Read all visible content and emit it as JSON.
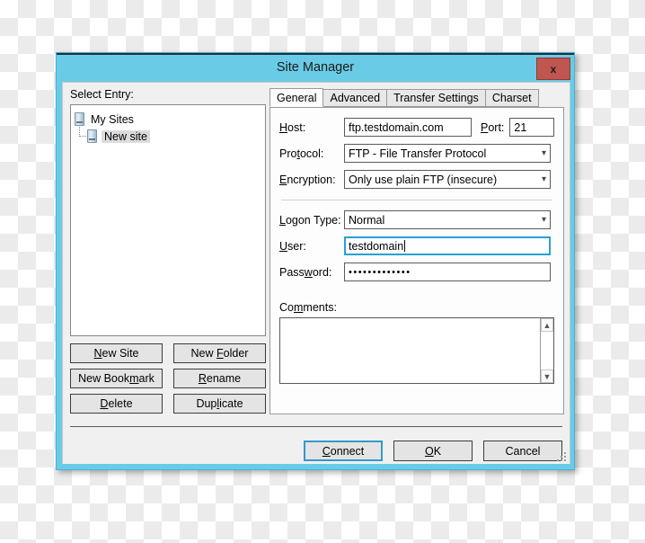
{
  "window": {
    "title": "Site Manager",
    "close_label": "x",
    "titlebar_color": "#6ACBE6",
    "close_color": "#c0564f"
  },
  "left": {
    "select_entry_label": "Select Entry:",
    "tree": [
      {
        "label": "My Sites",
        "icon": "server-icon",
        "selected": false
      },
      {
        "label": "New site",
        "icon": "server-icon",
        "selected": true
      }
    ],
    "buttons": [
      {
        "name": "new-site",
        "pre": "N",
        "acc": "",
        "label": "New Site",
        "u": "N",
        "rest": "ew Site"
      },
      {
        "name": "new-folder",
        "label": "New Folder"
      },
      {
        "name": "new-bookmark",
        "label": "New Bookmark"
      },
      {
        "name": "rename",
        "label": "Rename"
      },
      {
        "name": "delete",
        "label": "Delete"
      },
      {
        "name": "duplicate",
        "label": "Duplicate"
      }
    ]
  },
  "tabs": [
    {
      "label": "General",
      "active": true
    },
    {
      "label": "Advanced",
      "active": false
    },
    {
      "label": "Transfer Settings",
      "active": false
    },
    {
      "label": "Charset",
      "active": false
    }
  ],
  "general": {
    "host_label": "Host:",
    "host_value": "ftp.testdomain.com",
    "port_label": "Port:",
    "port_value": "21",
    "protocol_label": "Protocol:",
    "protocol_value": "FTP - File Transfer Protocol",
    "encryption_label": "Encryption:",
    "encryption_value": "Only use plain FTP (insecure)",
    "logon_type_label": "Logon Type:",
    "logon_type_value": "Normal",
    "user_label": "User:",
    "user_value": "testdomain",
    "password_label": "Password:",
    "password_value": "•••••••••••••",
    "comments_label": "Comments:",
    "comments_value": "",
    "scroll_up": "⌃",
    "scroll_down": "⌄",
    "dropdown_chevron": "⌄"
  },
  "footer": {
    "connect_label": "Connect",
    "ok_label": "OK",
    "cancel_label": "Cancel"
  }
}
